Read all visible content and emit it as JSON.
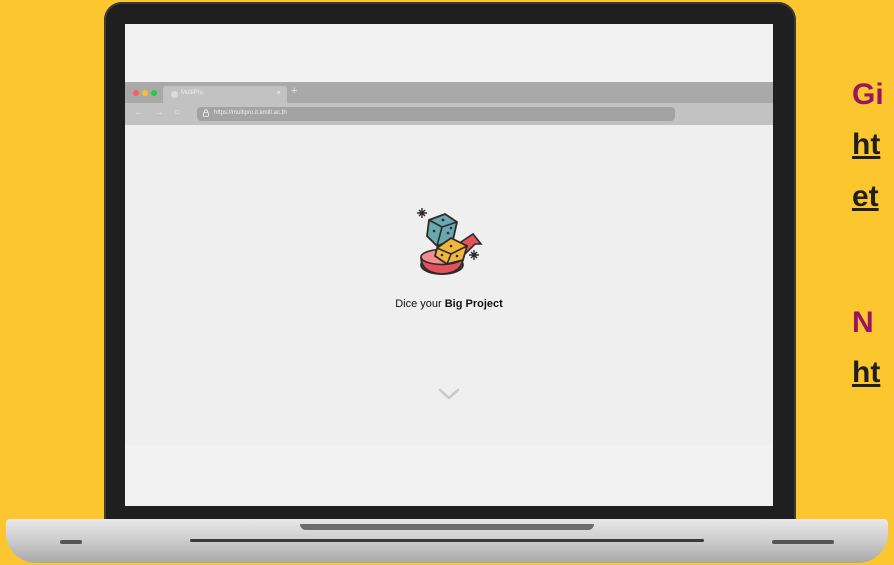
{
  "browser": {
    "tab_title": "MultiPro",
    "tab_close": "×",
    "new_tab": "+",
    "nav": {
      "back": "←",
      "forward": "→",
      "reload": "○"
    },
    "url": "https://multipro.it.kmitl.ac.th",
    "traffic_colors": [
      "#ff5f57",
      "#febc2e",
      "#28c840"
    ]
  },
  "page": {
    "logo_icon": "dice-ribbon-icon",
    "tagline_prefix": "Dice your ",
    "tagline_bold": "Big Project",
    "scroll_icon": "chevron-down-icon"
  },
  "side": {
    "heading_1": "Gi",
    "link_1": "ht",
    "link_2": "et",
    "heading_2": "N",
    "link_3": "ht"
  },
  "colors": {
    "background": "#fcc72e",
    "heading": "#9c1360"
  }
}
